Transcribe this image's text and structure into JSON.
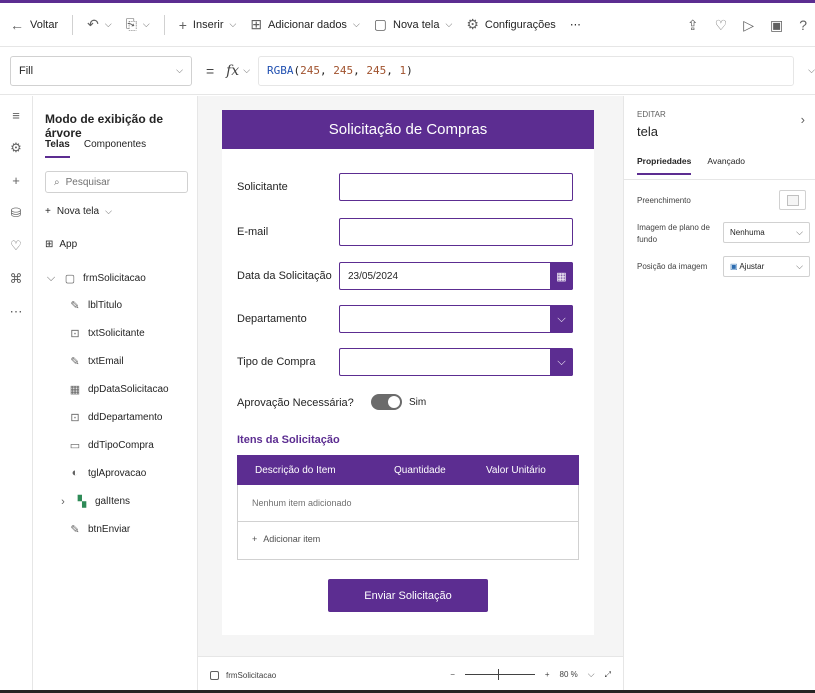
{
  "toolbar": {
    "back": "Voltar",
    "insert": "Inserir",
    "add_data": "Adicionar dados",
    "new_screen": "Nova tela",
    "settings": "Configurações",
    "more": "⋯"
  },
  "formula_bar": {
    "property": "Fill",
    "eq": "=",
    "fx": "fx",
    "fn": "RGBA",
    "args": [
      "245",
      "245",
      "245",
      "1"
    ]
  },
  "tree": {
    "title": "Modo de exibição de árvore",
    "tab_screens": "Telas",
    "tab_components": "Componentes",
    "search_placeholder": "Pesquisar",
    "new_screen": "Nova tela",
    "app": "App",
    "items": [
      "frmSolicitacao",
      "lblTitulo",
      "txtSolicitante",
      "txtEmail",
      "dpDataSolicitacao",
      "ddDepartamento",
      "ddTipoCompra",
      "tglAprovacao",
      "galItens",
      "btnEnviar"
    ]
  },
  "form": {
    "title": "Solicitação de Compras",
    "label_requester": "Solicitante",
    "label_email": "E-mail",
    "label_date": "Data da Solicitação",
    "date_value": "23/05/2024",
    "label_department": "Departamento",
    "label_purchase_type": "Tipo de Compra",
    "label_approval": "Aprovação Necessária?",
    "toggle_value": "Sim",
    "items_title": "Itens da Solicitação",
    "grid_headers": [
      "Descrição do Item",
      "Quantidade",
      "Valor Unitário"
    ],
    "grid_empty": "Nenhum item adicionado",
    "grid_add": "Adicionar item",
    "submit": "Enviar Solicitação"
  },
  "props": {
    "edit": "EDITAR",
    "screen": "tela",
    "tab_props": "Propriedades",
    "tab_adv": "Avançado",
    "fill": "Preenchimento",
    "bg_image": "Imagem de plano de fundo",
    "bg_image_value": "Nenhuma",
    "img_position": "Posição da imagem",
    "img_position_value": "Ajustar"
  },
  "status": {
    "screen_name": "frmSolicitacao",
    "zoom": "80 %"
  },
  "colors": {
    "accent": "#5c2d91",
    "canvas_bg": "#f5f5f5"
  }
}
